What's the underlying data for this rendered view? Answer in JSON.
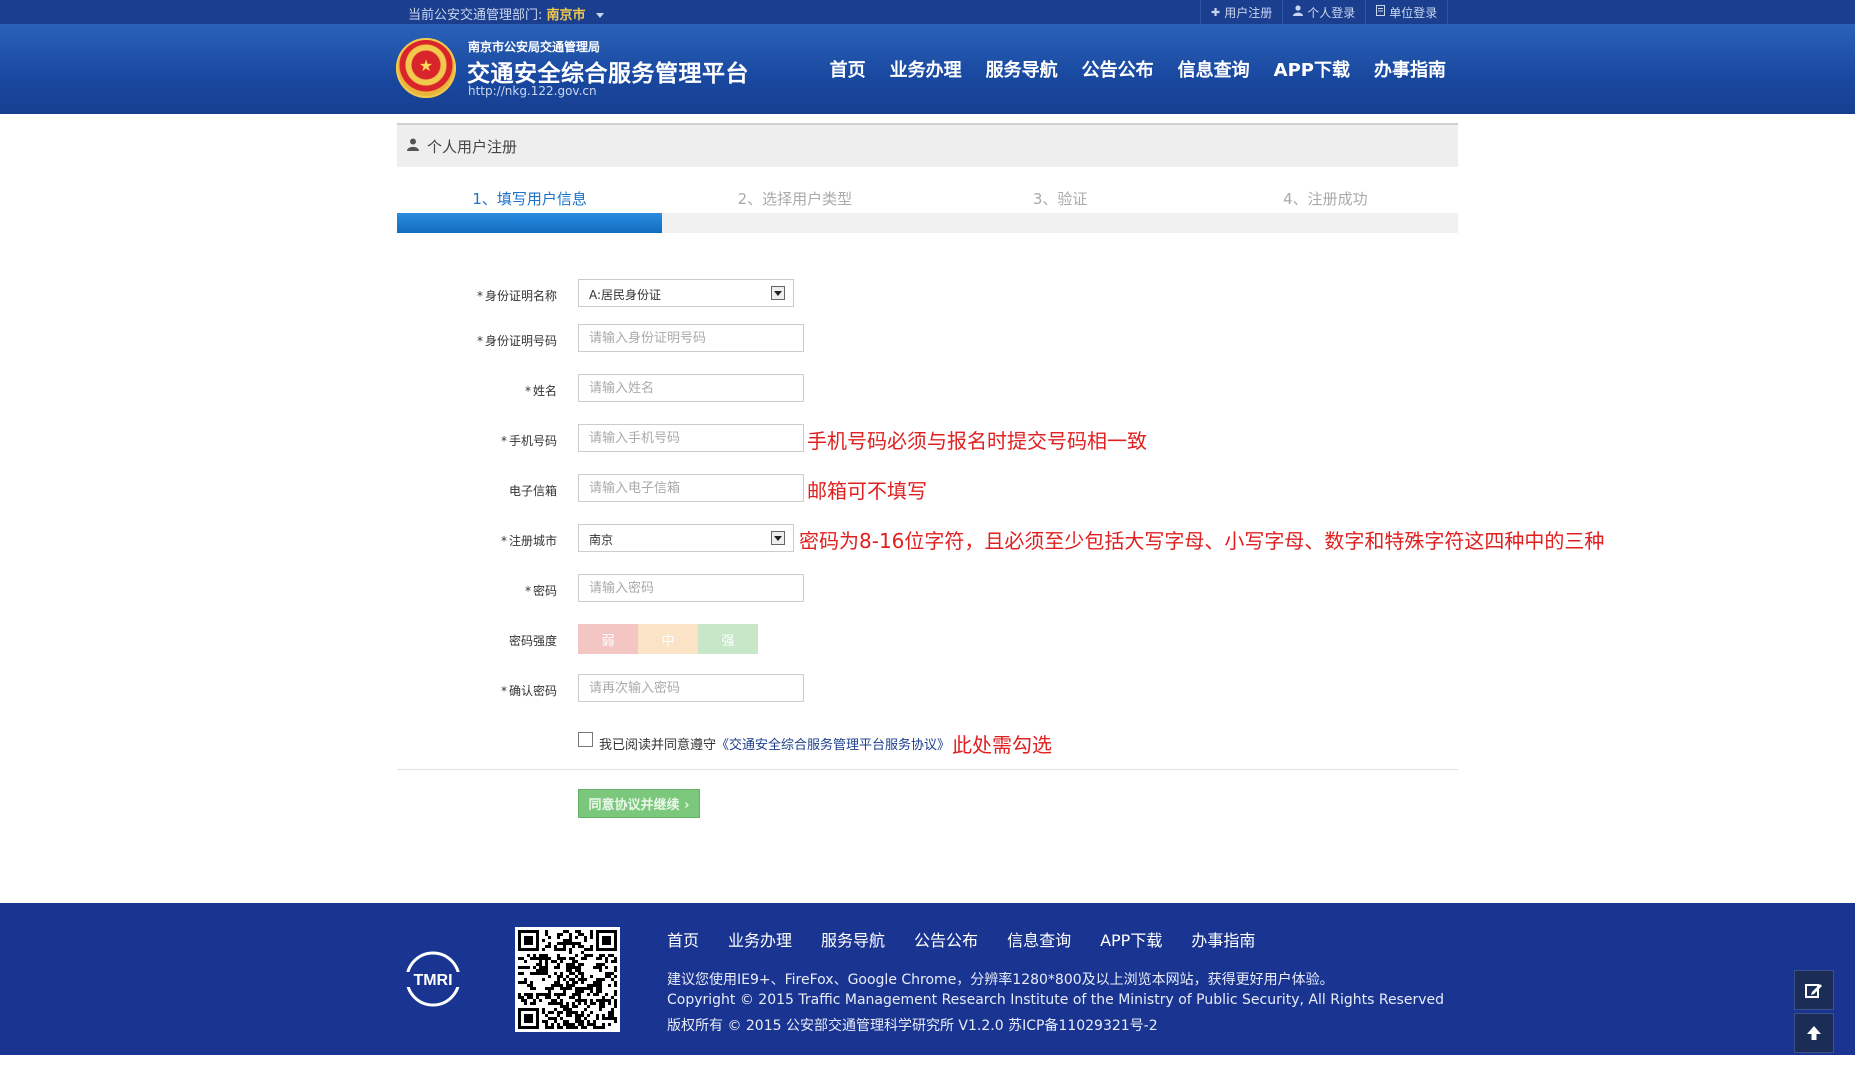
{
  "topbar": {
    "dept_prefix": "当前公安交通管理部门:",
    "dept_city": "南京市",
    "links": [
      {
        "icon": "plus-icon",
        "label": "用户注册"
      },
      {
        "icon": "user-icon",
        "label": "个人登录"
      },
      {
        "icon": "document-icon",
        "label": "单位登录"
      }
    ]
  },
  "header": {
    "subtitle": "南京市公安局交通管理局",
    "title": "交通安全综合服务管理平台",
    "url": "http://nkg.122.gov.cn",
    "nav": [
      "首页",
      "业务办理",
      "服务导航",
      "公告公布",
      "信息查询",
      "APP下载",
      "办事指南"
    ]
  },
  "panel": {
    "title": "个人用户注册",
    "steps": [
      "1、填写用户信息",
      "2、选择用户类型",
      "3、验证",
      "4、注册成功"
    ],
    "active_step": 1,
    "progress_fraction": 0.25
  },
  "form": {
    "id_type": {
      "label": "身份证明名称",
      "value": "A:居民身份证"
    },
    "id_number": {
      "label": "身份证明号码",
      "placeholder": "请输入身份证明号码"
    },
    "name": {
      "label": "姓名",
      "placeholder": "请输入姓名"
    },
    "phone": {
      "label": "手机号码",
      "placeholder": "请输入手机号码"
    },
    "email": {
      "label": "电子信箱",
      "placeholder": "请输入电子信箱"
    },
    "city": {
      "label": "注册城市",
      "value": "南京"
    },
    "password": {
      "label": "密码",
      "placeholder": "请输入密码"
    },
    "strength": {
      "label": "密码强度",
      "weak": "弱",
      "mid": "中",
      "strong": "强"
    },
    "confirm": {
      "label": "确认密码",
      "placeholder": "请再次输入密码"
    },
    "required_mark": "*"
  },
  "annotations": {
    "phone_note": "手机号码必须与报名时提交号码相一致",
    "email_note": "邮箱可不填写",
    "password_note": "密码为8-16位字符，且必须至少包括大写字母、小写字母、数字和特殊字符这四种中的三种",
    "agree_note": "此处需勾选"
  },
  "agreement": {
    "text": "我已阅读并同意遵守",
    "link": "《交通安全综合服务管理平台服务协议》",
    "checked": false
  },
  "submit_label": "同意协议并继续 ›",
  "footer": {
    "logo_text": "TMRI",
    "nav": [
      "首页",
      "业务办理",
      "服务导航",
      "公告公布",
      "信息查询",
      "APP下载",
      "办事指南"
    ],
    "line1": "建议您使用IE9+、FireFox、Google Chrome，分辨率1280*800及以上浏览本网站，获得更好用户体验。",
    "line2": "Copyright © 2015 Traffic Management Research Institute of the Ministry of Public Security, All Rights Reserved",
    "line3": "版权所有 © 2015 公安部交通管理科学研究所 V1.2.0 苏ICP备11029321号-2"
  },
  "colors": {
    "header_blue": "#1948a0",
    "footer_blue": "#1a3591",
    "active_step": "#1a73c9",
    "annotation_red": "#e02020"
  }
}
